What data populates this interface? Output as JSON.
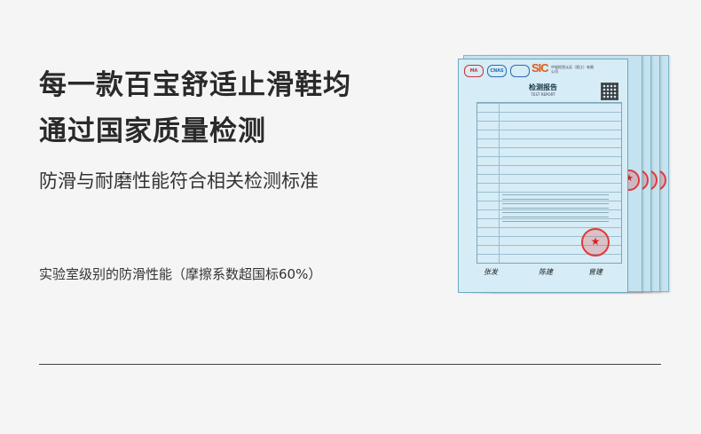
{
  "headline": {
    "line1": "每一款百宝舒适止滑鞋均",
    "line2": "通过国家质量检测"
  },
  "subtitle": "防滑与耐磨性能符合相关检测标准",
  "note": "实验室级别的防滑性能（摩擦系数超国标60%）",
  "report": {
    "logo_left": "MA",
    "logo_mid": "CNAS",
    "logo_sic": "SIC",
    "company": "中轻检验认证（晋江）有限公司",
    "title": "检测报告",
    "subtitle": "TEST REPORT",
    "signatures": [
      "张发",
      "陈建",
      "曾建"
    ]
  },
  "colors": {
    "background": "#f5f5f5",
    "paper": "#d6ecf6",
    "stamp": "#e03a3a",
    "sic": "#e05a1c"
  }
}
